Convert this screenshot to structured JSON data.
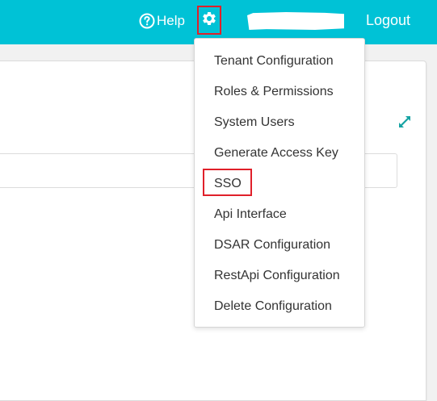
{
  "colors": {
    "topbar": "#00c2d6",
    "highlight": "#e0202a",
    "menu_text": "#333333",
    "expand_icon": "#16a3a3"
  },
  "header": {
    "help_label": "Help",
    "help_icon": "question-circle-icon",
    "settings_icon": "gear-icon",
    "logout_label": "Logout"
  },
  "settings_menu": {
    "items": [
      {
        "label": "Tenant Configuration"
      },
      {
        "label": "Roles & Permissions"
      },
      {
        "label": "System Users"
      },
      {
        "label": "Generate Access Key"
      },
      {
        "label": "SSO"
      },
      {
        "label": "Api Interface"
      },
      {
        "label": "DSAR Configuration"
      },
      {
        "label": "RestApi Configuration"
      },
      {
        "label": "Delete Configuration"
      }
    ],
    "highlighted": "SSO"
  },
  "main": {
    "expand_icon": "expand-arrows-icon"
  }
}
